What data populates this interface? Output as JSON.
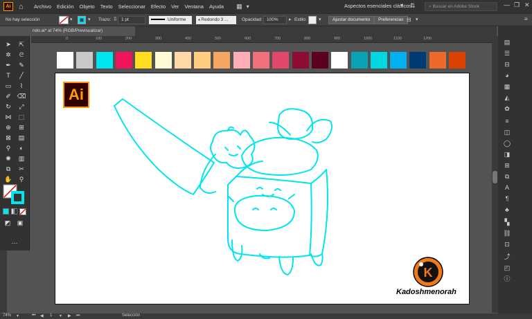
{
  "menubar": {
    "app_logo": "Ai",
    "menus": [
      "Archivo",
      "Edición",
      "Objeto",
      "Texto",
      "Seleccionar",
      "Efecto",
      "Ver",
      "Ventana",
      "Ayuda"
    ],
    "workspace": "Aspectos esenciales clásicos",
    "search_placeholder": "Buscar en Adobe Stock"
  },
  "controlbar": {
    "selection": "No hay selección",
    "stroke_label": "Trazo:",
    "stroke_weight": "1 pt",
    "profile": "Uniforme",
    "brush": "Redondo 3 ...",
    "opacity_label": "Opacidad:",
    "opacity_value": "100%",
    "style_label": "Estilo:",
    "doc_settings": "Ajustar documento",
    "preferences": "Preferencias"
  },
  "tab": {
    "title": "ndo.ai* al 74% (RGB/Previsualizar)"
  },
  "ruler": {
    "ticks": [
      "0",
      "100",
      "200",
      "300",
      "400",
      "500",
      "600",
      "700",
      "800",
      "900",
      "1000",
      "1100",
      "1200"
    ]
  },
  "swatches": [
    "#ffffff",
    "#c9c9c9",
    "#00e5ee",
    "#f0145a",
    "#ffde21",
    "#fffbd6",
    "#ffd9a8",
    "#ffcc80",
    "#f5a662",
    "#ffadb9",
    "#f0707c",
    "#e0476b",
    "#8c0d31",
    "#5c0020",
    "#ffffff",
    "#0aa3b5",
    "#00d9e0",
    "#00b0f0",
    "#003b73",
    "#ee6a2a",
    "#d94200"
  ],
  "artboard": {
    "ai_badge": "Ai",
    "signature": "Kadoshmenorah",
    "kd_letter": "K"
  },
  "statusbar": {
    "zoom": "74%",
    "page": "1",
    "tool": "Selección"
  },
  "colors": {
    "stroke_cyan": "#00e5ee",
    "accent_orange": "#ff9a00"
  }
}
